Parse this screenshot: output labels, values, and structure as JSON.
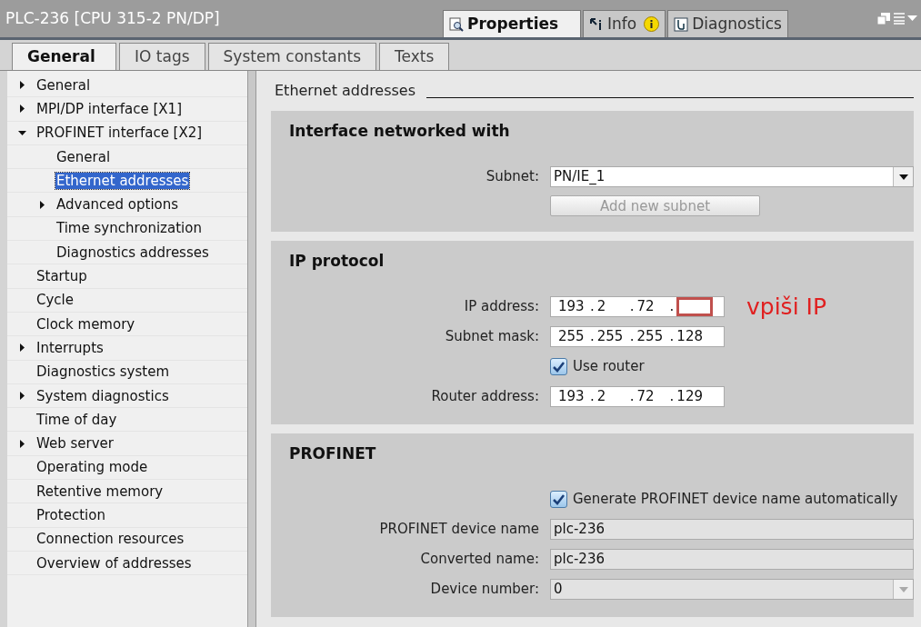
{
  "window": {
    "title": "PLC-236 [CPU 315-2 PN/DP]"
  },
  "inspector_tabs": [
    {
      "label": "Properties",
      "selected": true,
      "kind": "properties"
    },
    {
      "label": "Info",
      "selected": false,
      "kind": "info"
    },
    {
      "label": "Diagnostics",
      "selected": false,
      "kind": "diagnostics"
    }
  ],
  "tabs": [
    {
      "label": "General",
      "selected": true
    },
    {
      "label": "IO tags",
      "selected": false
    },
    {
      "label": "System constants",
      "selected": false
    },
    {
      "label": "Texts",
      "selected": false
    }
  ],
  "sidebar": {
    "items": [
      {
        "label": "General",
        "expanded": false,
        "selected": false
      },
      {
        "label": "MPI/DP interface [X1]",
        "expanded": false,
        "selected": false
      },
      {
        "label": "PROFINET interface [X2]",
        "expanded": true,
        "selected": false,
        "children": [
          {
            "label": "General",
            "selected": false
          },
          {
            "label": "Ethernet addresses",
            "selected": true
          },
          {
            "label": "Advanced options",
            "expanded": false,
            "selected": false
          },
          {
            "label": "Time synchronization",
            "selected": false
          },
          {
            "label": "Diagnostics addresses",
            "selected": false
          }
        ]
      },
      {
        "label": "Startup",
        "selected": false
      },
      {
        "label": "Cycle",
        "selected": false
      },
      {
        "label": "Clock memory",
        "selected": false
      },
      {
        "label": "Interrupts",
        "expanded": false,
        "selected": false
      },
      {
        "label": "Diagnostics system",
        "selected": false
      },
      {
        "label": "System diagnostics",
        "expanded": false,
        "selected": false
      },
      {
        "label": "Time of day",
        "selected": false
      },
      {
        "label": "Web server",
        "expanded": false,
        "selected": false
      },
      {
        "label": "Operating mode",
        "selected": false
      },
      {
        "label": "Retentive memory",
        "selected": false
      },
      {
        "label": "Protection",
        "selected": false
      },
      {
        "label": "Connection resources",
        "selected": false
      },
      {
        "label": "Overview of addresses",
        "selected": false
      }
    ]
  },
  "content": {
    "heading": "Ethernet addresses",
    "separator": ".",
    "sections": [
      {
        "title": "Interface networked with",
        "rows": [
          {
            "kind": "dropdown",
            "label": "Subnet:",
            "value": "PN/IE_1",
            "disabled": false
          },
          {
            "kind": "button",
            "label": "Add new subnet",
            "disabled": true
          }
        ]
      },
      {
        "title": "IP protocol",
        "rows": [
          {
            "kind": "ip",
            "label": "IP address:",
            "octets": [
              {
                "value": "193",
                "highlighted": false
              },
              {
                "value": "2",
                "highlighted": false
              },
              {
                "value": "72",
                "highlighted": false
              },
              {
                "highlighted": true
              }
            ],
            "annotation": "vpiši IP"
          },
          {
            "kind": "ip",
            "label": "Subnet mask:",
            "octets": [
              {
                "value": "255",
                "highlighted": false
              },
              {
                "value": "255",
                "highlighted": false
              },
              {
                "value": "255",
                "highlighted": false
              },
              {
                "value": "128",
                "highlighted": false
              }
            ]
          },
          {
            "kind": "checkbox",
            "label": "Use router",
            "checked": true
          },
          {
            "kind": "ip",
            "label": "Router address:",
            "octets": [
              {
                "value": "193",
                "highlighted": false
              },
              {
                "value": "2",
                "highlighted": false
              },
              {
                "value": "72",
                "highlighted": false
              },
              {
                "value": "129",
                "highlighted": false
              }
            ]
          }
        ]
      },
      {
        "title": "PROFINET",
        "rows": [
          {
            "kind": "checkbox",
            "label": "Generate PROFINET device name automatically",
            "checked": true
          },
          {
            "kind": "text",
            "label": "PROFINET device name",
            "value": "plc-236",
            "disabled": true
          },
          {
            "kind": "text",
            "label": "Converted name:",
            "value": "plc-236",
            "disabled": true
          },
          {
            "kind": "dropdown",
            "label": "Device number:",
            "value": "0",
            "disabled": true
          }
        ]
      }
    ]
  }
}
